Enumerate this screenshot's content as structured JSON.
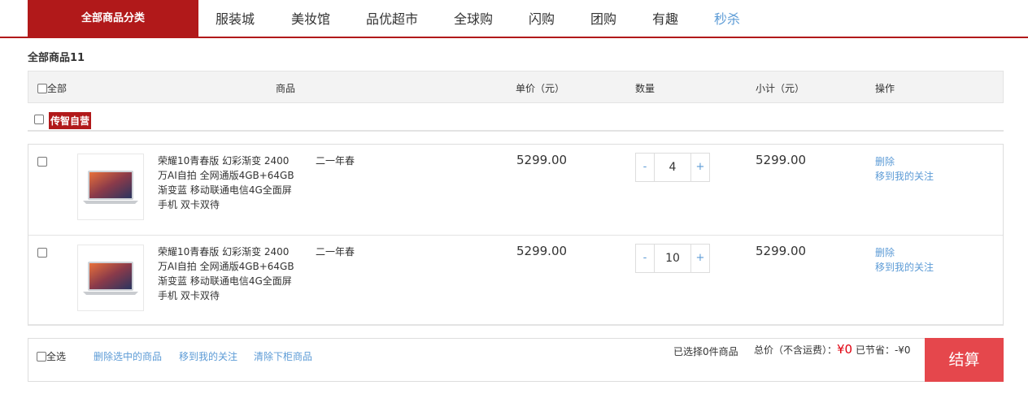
{
  "nav": {
    "category_label": "全部商品分类",
    "links": [
      "服装城",
      "美妆馆",
      "品优超市",
      "全球购",
      "闪购",
      "团购",
      "有趣",
      "秒杀"
    ]
  },
  "cart": {
    "title": "全部商品11",
    "headers": {
      "select_all": "全部",
      "product": "商品",
      "unit_price": "单价（元）",
      "quantity": "数量",
      "subtotal": "小计（元）",
      "actions": "操作"
    },
    "shop_name": "传智自营",
    "items": [
      {
        "title": "荣耀10青春版 幻彩渐变 2400万AI自拍 全网通版4GB+64GB 渐变蓝 移动联通电信4G全面屏手机 双卡双待",
        "property": "二一年春",
        "price": "5299.00",
        "quantity": "4",
        "subtotal": "5299.00",
        "delete_label": "删除",
        "move_label": "移到我的关注"
      },
      {
        "title": "荣耀10青春版 幻彩渐变 2400万AI自拍 全网通版4GB+64GB 渐变蓝 移动联通电信4G全面屏手机 双卡双待",
        "property": "二一年春",
        "price": "5299.00",
        "quantity": "10",
        "subtotal": "5299.00",
        "delete_label": "删除",
        "move_label": "移到我的关注"
      }
    ],
    "qty_minus": "-",
    "qty_plus": "+"
  },
  "footer": {
    "select_all": "全选",
    "delete_selected": "删除选中的商品",
    "move_to_favorites": "移到我的关注",
    "clear_removed": "清除下柜商品",
    "selected_count": "已选择0件商品",
    "total_label": "总价（不含运费）：",
    "total_value": "¥0",
    "saved_label": "已节省：",
    "saved_value": "-¥0",
    "checkout_label": "结算"
  },
  "colors": {
    "brand_red": "#b1191a",
    "link_blue": "#5c9bd6",
    "checkout_red": "#e5474c",
    "price_red": "#e0000f"
  }
}
